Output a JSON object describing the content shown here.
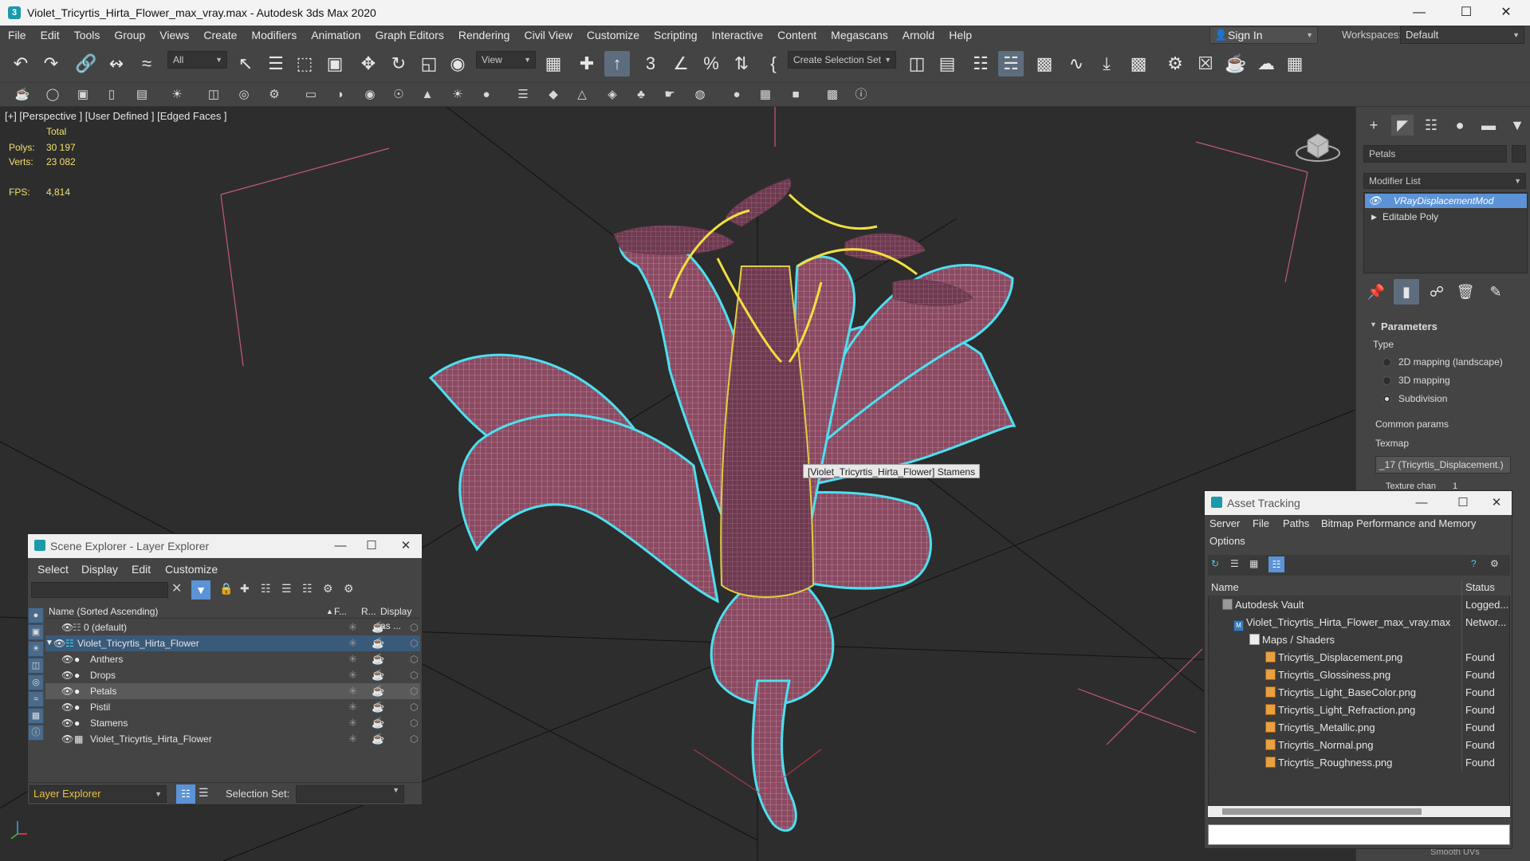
{
  "window": {
    "title": "Violet_Tricyrtis_Hirta_Flower_max_vray.max - Autodesk 3ds Max 2020",
    "app_icon": "3ds-max-icon"
  },
  "menubar": [
    "File",
    "Edit",
    "Tools",
    "Group",
    "Views",
    "Create",
    "Modifiers",
    "Animation",
    "Graph Editors",
    "Rendering",
    "Civil View",
    "Customize",
    "Scripting",
    "Interactive",
    "Content",
    "Megascans",
    "Arnold",
    "Help"
  ],
  "signin": {
    "label": "Sign In"
  },
  "workspaces": {
    "label": "Workspaces:",
    "value": "Default"
  },
  "toolbar": {
    "selection_filter": "All",
    "ref_coord": "View",
    "selection_set": "Create Selection Set"
  },
  "viewport": {
    "label": "[+] [Perspective ] [User Defined ] [Edged Faces ]",
    "stats": {
      "total_label": "Total",
      "polys_label": "Polys:",
      "polys_value": "30 197",
      "verts_label": "Verts:",
      "verts_value": "23 082",
      "fps_label": "FPS:",
      "fps_value": "4,814"
    },
    "tooltip": "[Violet_Tricyrtis_Hirta_Flower] Stamens"
  },
  "command_panel": {
    "object_name": "Petals",
    "modifier_list": "Modifier List",
    "stack": [
      "VRayDisplacementMod",
      "Editable Poly"
    ],
    "rollout_title": "Parameters",
    "type_label": "Type",
    "type_options": [
      "2D mapping (landscape)",
      "3D mapping",
      "Subdivision"
    ],
    "type_selected": 2,
    "common_params": "Common params",
    "texmap_label": "Texmap",
    "texmap_value": "_17 (Tricyrtis_Displacement.)",
    "texture_chan": "Texture chan",
    "texture_chan_value": "1",
    "smooth_uvs": "Smooth UVs"
  },
  "scene_explorer": {
    "title": "Scene Explorer - Layer Explorer",
    "menu": [
      "Select",
      "Display",
      "Edit",
      "Customize"
    ],
    "columns": {
      "name": "Name (Sorted Ascending)",
      "c1": "F...",
      "c2": "R...",
      "c3": "Display as ..."
    },
    "rows": [
      {
        "name": "0 (default)",
        "level": 1,
        "selected": false
      },
      {
        "name": "Violet_Tricyrtis_Hirta_Flower",
        "level": 1,
        "selected": true
      },
      {
        "name": "Anthers",
        "level": 2,
        "selected": false
      },
      {
        "name": "Drops",
        "level": 2,
        "selected": false
      },
      {
        "name": "Petals",
        "level": 2,
        "selected": false,
        "highlight": true
      },
      {
        "name": "Pistil",
        "level": 2,
        "selected": false
      },
      {
        "name": "Stamens",
        "level": 2,
        "selected": false
      },
      {
        "name": "Violet_Tricyrtis_Hirta_Flower",
        "level": 2,
        "selected": false
      }
    ],
    "footer_layer": "Layer Explorer",
    "footer_selset_label": "Selection Set:"
  },
  "asset_tracking": {
    "title": "Asset Tracking",
    "menu": [
      "Server",
      "File",
      "Paths",
      "Bitmap Performance and Memory",
      "Options"
    ],
    "columns": {
      "name": "Name",
      "status": "Status"
    },
    "rows": [
      {
        "name": "Autodesk Vault",
        "status": "Logged...",
        "indent": 1
      },
      {
        "name": "Violet_Tricyrtis_Hirta_Flower_max_vray.max",
        "status": "Networ...",
        "indent": 2
      },
      {
        "name": "Maps / Shaders",
        "status": "",
        "indent": 3
      },
      {
        "name": "Tricyrtis_Displacement.png",
        "status": "Found",
        "indent": 4
      },
      {
        "name": "Tricyrtis_Glossiness.png",
        "status": "Found",
        "indent": 4
      },
      {
        "name": "Tricyrtis_Light_BaseColor.png",
        "status": "Found",
        "indent": 4
      },
      {
        "name": "Tricyrtis_Light_Refraction.png",
        "status": "Found",
        "indent": 4
      },
      {
        "name": "Tricyrtis_Metallic.png",
        "status": "Found",
        "indent": 4
      },
      {
        "name": "Tricyrtis_Normal.png",
        "status": "Found",
        "indent": 4
      },
      {
        "name": "Tricyrtis_Roughness.png",
        "status": "Found",
        "indent": 4
      }
    ]
  },
  "colors": {
    "accent": "#5b93d6",
    "petal": "#8a4a62",
    "selection_outline": "#4de0f0",
    "stamen_outline": "#f0e040",
    "stats_text": "#f0e070"
  }
}
